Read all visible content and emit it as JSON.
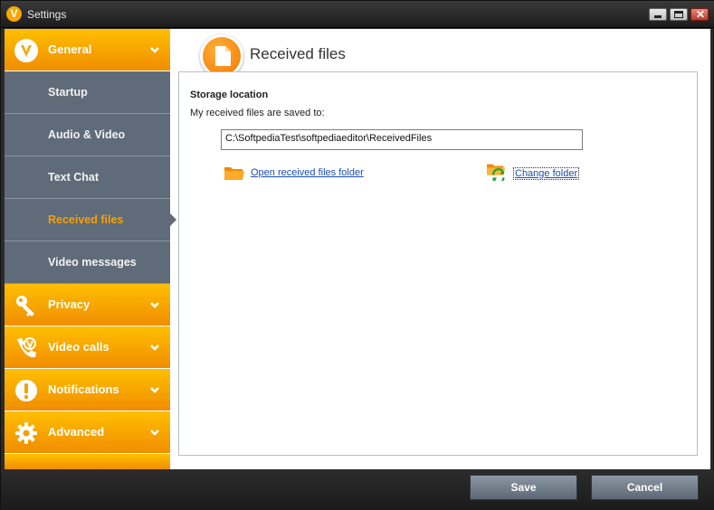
{
  "window": {
    "title": "Settings",
    "app_icon": "viber-v-icon"
  },
  "sidebar": {
    "items": [
      {
        "label": "General",
        "type": "category",
        "icon": "viber-logo-icon",
        "expanded": true
      },
      {
        "label": "Startup",
        "type": "sub"
      },
      {
        "label": "Audio & Video",
        "type": "sub"
      },
      {
        "label": "Text Chat",
        "type": "sub"
      },
      {
        "label": "Received files",
        "type": "sub",
        "active": true
      },
      {
        "label": "Video messages",
        "type": "sub"
      },
      {
        "label": "Privacy",
        "type": "category",
        "icon": "key-icon"
      },
      {
        "label": "Video calls",
        "type": "category",
        "icon": "phone-icon"
      },
      {
        "label": "Notifications",
        "type": "category",
        "icon": "exclamation-icon"
      },
      {
        "label": "Advanced",
        "type": "category",
        "icon": "gear-icon"
      }
    ]
  },
  "main": {
    "title": "Received files",
    "storage": {
      "heading": "Storage location",
      "description": "My received files are saved to:",
      "path": "C:\\SoftpediaTest\\softpediaeditor\\ReceivedFiles",
      "open_link": "Open received files folder",
      "change_link": "Change folder"
    }
  },
  "footer": {
    "save_label": "Save",
    "cancel_label": "Cancel"
  },
  "colors": {
    "accent": "#f7a700",
    "sidebar": "#5f6b78",
    "active_text": "#f7a000",
    "link": "#1a4db3"
  }
}
